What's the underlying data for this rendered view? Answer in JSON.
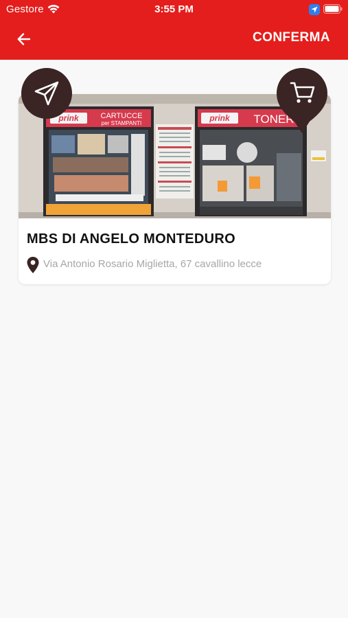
{
  "status_bar": {
    "carrier": "Gestore",
    "time": "3:55 PM"
  },
  "nav": {
    "back_icon": "arrow-left-icon",
    "confirm_label": "CONFERMA"
  },
  "theme": {
    "header_color": "#e41e1c",
    "fab_color": "#3a2424",
    "background": "#f8f8f8"
  },
  "store": {
    "name": "MBS DI ANGELO MONTEDURO",
    "address": "Via Antonio Rosario Miglietta, 67 cavallino lecce",
    "photo_sign_left_brand": "prink",
    "photo_sign_left_text": "CARTUCCE",
    "photo_sign_left_sub": "per STAMPANTI",
    "photo_sign_right_brand": "prink",
    "photo_sign_right_text": "TONER"
  },
  "actions": {
    "left_icon": "paper-plane-icon",
    "right_icon": "shopping-cart-icon"
  }
}
